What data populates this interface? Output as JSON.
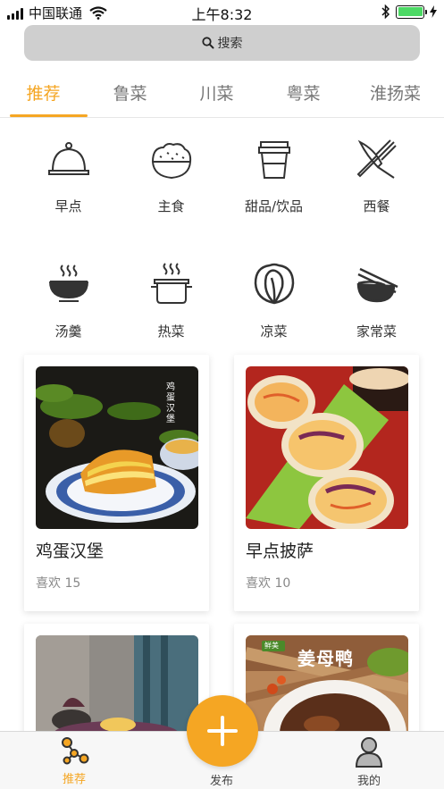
{
  "status_bar": {
    "carrier": "中国联通",
    "time": "上午8:32",
    "battery_level": 1.0
  },
  "search": {
    "label": "搜索"
  },
  "tabs": [
    {
      "label": "推荐",
      "active": true
    },
    {
      "label": "鲁菜",
      "active": false
    },
    {
      "label": "川菜",
      "active": false
    },
    {
      "label": "粤菜",
      "active": false
    },
    {
      "label": "淮扬菜",
      "active": false
    }
  ],
  "categories": [
    {
      "label": "早点",
      "icon": "cloche-icon"
    },
    {
      "label": "主食",
      "icon": "rice-bowl-icon"
    },
    {
      "label": "甜品/饮品",
      "icon": "drink-cup-icon"
    },
    {
      "label": "西餐",
      "icon": "fork-knife-icon"
    },
    {
      "label": "汤羹",
      "icon": "soup-bowl-icon"
    },
    {
      "label": "热菜",
      "icon": "hot-pot-icon"
    },
    {
      "label": "凉菜",
      "icon": "cabbage-icon"
    },
    {
      "label": "家常菜",
      "icon": "bowl-chopsticks-icon"
    }
  ],
  "recipes": [
    {
      "title": "鸡蛋汉堡",
      "likes": "喜欢 15",
      "image_text": "鸡蛋汉堡"
    },
    {
      "title": "早点披萨",
      "likes": "喜欢 10"
    },
    {
      "title": "",
      "likes": ""
    },
    {
      "title": "",
      "likes": "",
      "image_text": "姜母鸭",
      "image_badge": "鲜美"
    }
  ],
  "bottom_nav": {
    "items": [
      {
        "label": "推荐",
        "icon": "share-nodes-icon",
        "active": true
      },
      {
        "label": "发布",
        "icon": "plus-icon",
        "active": false
      },
      {
        "label": "我的",
        "icon": "user-icon",
        "active": false
      }
    ]
  },
  "colors": {
    "accent": "#f5a623",
    "battery": "#4cd964",
    "search_bg": "#cfcfcf"
  }
}
